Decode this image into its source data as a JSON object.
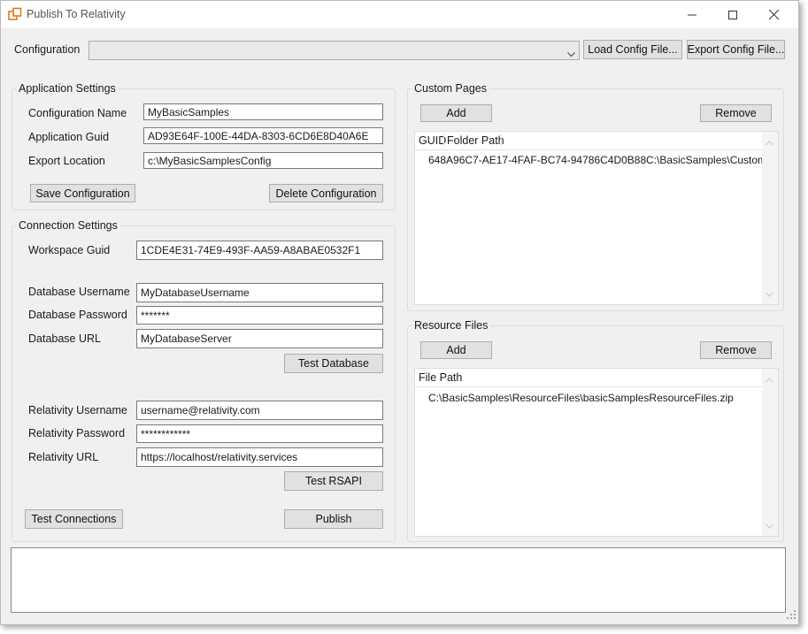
{
  "window": {
    "title": "Publish To Relativity",
    "controls": [
      "minimize-icon",
      "maximize-icon",
      "close-icon"
    ]
  },
  "config_bar": {
    "label": "Configuration",
    "selected": "",
    "load_button": "Load Config File...",
    "export_button": "Export Config File..."
  },
  "application_settings": {
    "title": "Application Settings",
    "config_name_label": "Configuration Name",
    "config_name_value": "MyBasicSamples",
    "app_guid_label": "Application Guid",
    "app_guid_value": "AD93E64F-100E-44DA-8303-6CD6E8D40A6E",
    "export_location_label": "Export Location",
    "export_location_value": "c:\\MyBasicSamplesConfig",
    "save_button": "Save Configuration",
    "delete_button": "Delete Configuration"
  },
  "connection_settings": {
    "title": "Connection Settings",
    "workspace_guid_label": "Workspace Guid",
    "workspace_guid_value": "1CDE4E31-74E9-493F-AA59-A8ABAE0532F1",
    "db_username_label": "Database Username",
    "db_username_value": "MyDatabaseUsername",
    "db_password_label": "Database Password",
    "db_password_value": "*******",
    "db_url_label": "Database URL",
    "db_url_value": "MyDatabaseServer",
    "test_database_button": "Test Database",
    "rel_username_label": "Relativity Username",
    "rel_username_value": "username@relativity.com",
    "rel_password_label": "Relativity Password",
    "rel_password_value": "************",
    "rel_url_label": "Relativity URL",
    "rel_url_value": "https://localhost/relativity.services",
    "test_rsapi_button": "Test RSAPI",
    "test_connections_button": "Test Connections",
    "publish_button": "Publish"
  },
  "custom_pages": {
    "title": "Custom Pages",
    "add_button": "Add",
    "remove_button": "Remove",
    "columns": [
      "GUID",
      "Folder Path"
    ],
    "rows": [
      {
        "guid": "648A96C7-AE17-4FAF-BC74-94786C4D0B88",
        "folder_path": "C:\\BasicSamples\\Custom"
      }
    ]
  },
  "resource_files": {
    "title": "Resource Files",
    "add_button": "Add",
    "remove_button": "Remove",
    "columns": [
      "File Path"
    ],
    "rows": [
      {
        "file_path": "C:\\BasicSamples\\ResourceFiles\\basicSamplesResourceFiles.zip"
      }
    ]
  },
  "status_output": ""
}
